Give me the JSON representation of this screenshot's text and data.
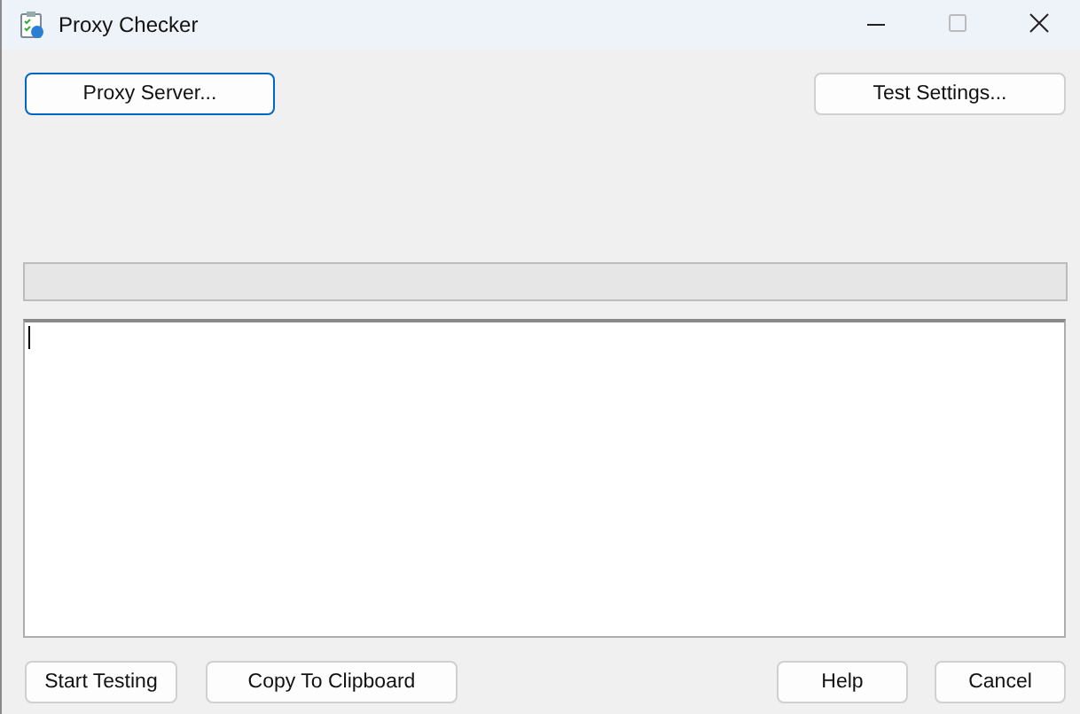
{
  "window": {
    "title": "Proxy Checker"
  },
  "top_buttons": [
    {
      "label": "Proxy Server...",
      "focused": true
    },
    {
      "label": "Test Settings...",
      "focused": false
    }
  ],
  "progress": {
    "level": 0
  },
  "bottom_buttons": [
    {
      "label": "Start Testing",
      "focused": false
    },
    {
      "label": "Copy To Clipboard",
      "focused": false
    },
    {
      "label": "Help",
      "focused": false
    },
    {
      "label": "Cancel",
      "focused": false
    }
  ]
}
